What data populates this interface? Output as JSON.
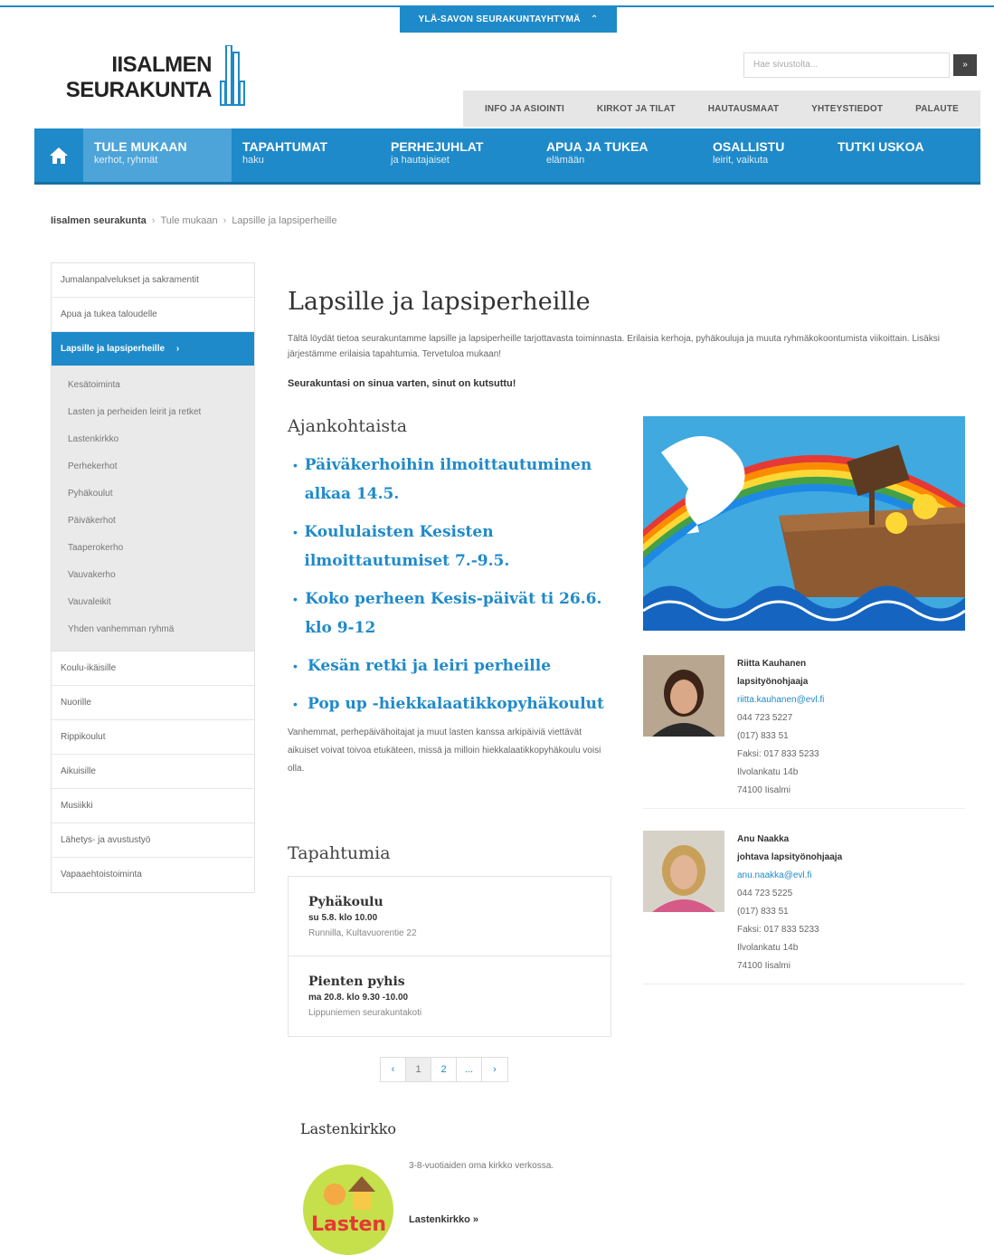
{
  "top_tab": {
    "label": "YLÄ-SAVON SEURAKUNTAYHTYMÄ",
    "icon": "chevron-up-icon"
  },
  "logo": {
    "line1": "IISALMEN",
    "line2": "SEURAKUNTA"
  },
  "search": {
    "placeholder": "Hae sivustolta...",
    "button_icon": "search-arrow-icon"
  },
  "util_nav": [
    "INFO JA ASIOINTI",
    "KIRKOT JA TILAT",
    "HAUTAUSMAAT",
    "YHTEYSTIEDOT",
    "PALAUTE"
  ],
  "main_nav": [
    {
      "title": "TULE MUKAAN",
      "sub": "kerhot, ryhmät"
    },
    {
      "title": "TAPAHTUMAT",
      "sub": "haku"
    },
    {
      "title": "PERHEJUHLAT",
      "sub": "ja hautajaiset"
    },
    {
      "title": "APUA JA TUKEA",
      "sub": "elämään"
    },
    {
      "title": "OSALLISTU",
      "sub": "leirit, vaikuta"
    },
    {
      "title": "TUTKI USKOA",
      "sub": ""
    }
  ],
  "breadcrumb": {
    "home": "Iisalmen seurakunta",
    "mid": "Tule mukaan",
    "current": "Lapsille ja lapsiperheille",
    "sep": "›"
  },
  "sidebar": {
    "items_top": [
      "Jumalanpalvelukset ja sakramentit",
      "Apua ja tukea taloudelle"
    ],
    "active": "Lapsille ja lapsiperheille",
    "active_icon": "›",
    "sub": [
      "Kesätoiminta",
      "Lasten ja perheiden leirit ja retket",
      "Lastenkirkko",
      "Perhekerhot",
      "Pyhäkoulut",
      "Päiväkerhot",
      "Taaperokerho",
      "Vauvakerho",
      "Vauvaleikit",
      "Yhden vanhemman ryhmä"
    ],
    "items_bottom": [
      "Koulu-ikäisille",
      "Nuorille",
      "Rippikoulut",
      "Aikuisille",
      "Musiikki",
      "Lähetys- ja avustustyö",
      "Vapaaehtoistoiminta"
    ]
  },
  "page": {
    "title": "Lapsille ja lapsiperheille",
    "intro": "Tältä löydät tietoa seurakuntamme lapsille ja lapsiperheille tarjottavasta toiminnasta. Erilaisia kerhoja, pyhäkouluja ja muuta ryhmäkokoontumista viikoittain. Lisäksi järjestämme erilaisia tapahtumia. Tervetuloa mukaan!",
    "tagline": "Seurakuntasi on sinua varten, sinut on kutsuttu!"
  },
  "news": {
    "title": "Ajankohtaista",
    "items": [
      "Päiväkerhoihin ilmoittautuminen alkaa 14.5.",
      "Koululaisten Kesisten ilmoittautumiset 7.-9.5.",
      "Koko perheen Kesis-päivät ti 26.6. klo 9-12",
      "Kesän retki ja leiri perheille",
      "Pop up -hiekkalaatikkopyhäkoulut"
    ],
    "bullet": "•",
    "desc": "Vanhemmat, perhepäivähoitajat ja muut lasten kanssa arkipäiviä viettävät aikuiset voivat toivoa etukäteen, missä ja milloin hiekkalaatikkopyhäkoulu voisi olla."
  },
  "contacts": [
    {
      "name": "Riitta Kauhanen",
      "role": "lapsityönohjaaja",
      "email": "riitta.kauhanen@evl.fi",
      "phone1": "044 723 5227",
      "phone2": "(017) 833 51",
      "fax": "Faksi: 017 833 5233",
      "street": "Ilvolankatu 14b",
      "city": "74100 Iisalmi"
    },
    {
      "name": "Anu Naakka",
      "role": "johtava lapsityönohjaaja",
      "email": "anu.naakka@evl.fi",
      "phone1": "044 723 5225",
      "phone2": "(017) 833 51",
      "fax": "Faksi: 017 833 5233",
      "street": "Ilvolankatu 14b",
      "city": "74100 Iisalmi"
    }
  ],
  "events": {
    "title": "Tapahtumia",
    "items": [
      {
        "title": "Pyhäkoulu",
        "date": "su 5.8. klo 10.00",
        "place": "Runnilla, Kultavuorentie 22"
      },
      {
        "title": "Pienten pyhis",
        "date": "ma 20.8. klo 9.30 -10.00",
        "place": "Lippuniemen seurakuntakoti"
      }
    ]
  },
  "pager": [
    "‹",
    "1",
    "2",
    "...",
    "›"
  ],
  "lastenkirkko": {
    "title": "Lastenkirkko",
    "desc": "3-8-vuotiaiden oma kirkko verkossa.",
    "link": "Lastenkirkko »",
    "logo_text": "Lasten"
  },
  "colors": {
    "accent": "#1f8ac9",
    "nav_active": "#4da4d8",
    "util_bg": "#e6e6e6"
  }
}
